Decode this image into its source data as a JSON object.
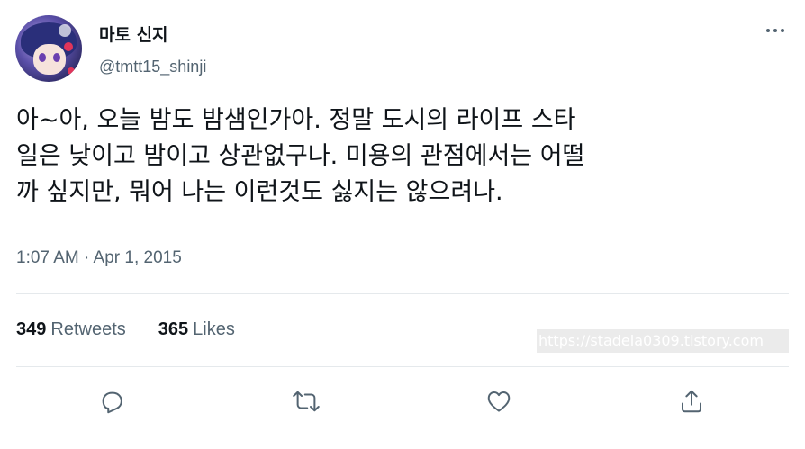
{
  "author": {
    "display_name": "마토 신지",
    "handle": "@tmtt15_shinji"
  },
  "tweet": {
    "text": "아~아, 오늘 밤도 밤샘인가아. 정말 도시의 라이프 스타\n일은 낮이고 밤이고 상관없구나. 미용의 관점에서는 어떨\n까 싶지만, 뭐어 나는 이런것도 싫지는 않으려나.",
    "timestamp": "1:07 AM · Apr 1, 2015"
  },
  "stats": {
    "retweets_count": "349",
    "retweets_label": "Retweets",
    "likes_count": "365",
    "likes_label": "Likes"
  },
  "watermark": "https://stadela0309.tistory.com",
  "icons": {
    "more": "more-horizontal-icon",
    "reply": "reply-icon",
    "retweet": "retweet-icon",
    "like": "heart-icon",
    "share": "share-icon"
  },
  "colors": {
    "text_primary": "#0f1419",
    "text_secondary": "#536471",
    "divider": "#e5e9ec"
  }
}
